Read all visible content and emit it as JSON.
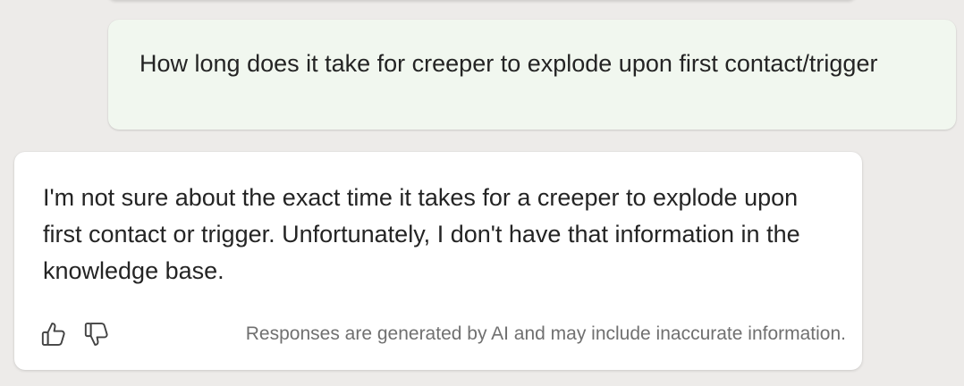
{
  "conversation": {
    "user_message": "How long does it take for creeper to explode upon first contact/trigger",
    "bot_message": "I'm not sure about the exact time it takes for a creeper to explode upon first contact or trigger. Unfortunately, I don't have that information in the knowledge base.",
    "feedback": {
      "thumbs_up_icon": "thumbs-up-icon",
      "thumbs_down_icon": "thumbs-down-icon",
      "disclaimer": "Responses are generated by AI and may include inaccurate information."
    }
  },
  "colors": {
    "background": "#edebe9",
    "user_bubble": "#f1f7ef",
    "bot_bubble": "#ffffff",
    "text": "#242424",
    "disclaimer_text": "#707070"
  }
}
